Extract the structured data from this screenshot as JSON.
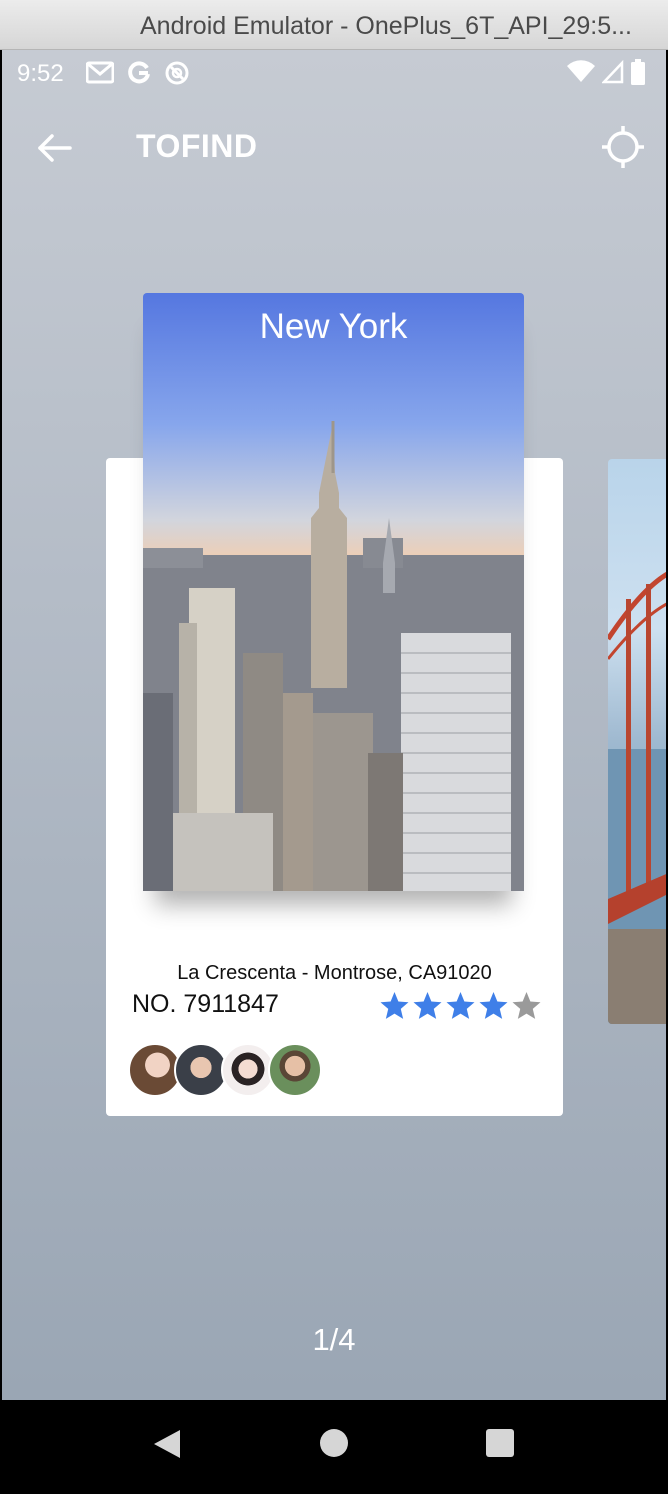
{
  "window": {
    "title": "Android Emulator - OnePlus_6T_API_29:5..."
  },
  "status_bar": {
    "time": "9:52",
    "left_icons": [
      "gmail-icon",
      "google-icon",
      "data-saver-icon"
    ],
    "right_icons": [
      "wifi-icon",
      "cell-signal-icon",
      "battery-icon"
    ]
  },
  "app_bar": {
    "back_icon": "arrow-back-icon",
    "title": "TOFIND",
    "action_icon": "my-location-icon"
  },
  "card": {
    "city": "New York",
    "location": "La Crescenta - Montrose, CA91020",
    "number": "NO. 7911847",
    "rating": {
      "value": 4,
      "max": 5
    },
    "avatars": [
      "avatar-1",
      "avatar-2",
      "avatar-3",
      "avatar-4"
    ]
  },
  "pager": {
    "indicator": "1/4"
  },
  "colors": {
    "star_active": "#3f7fe8",
    "star_inactive": "#9a9a9a",
    "card_bg": "#ffffff",
    "text_dark": "#111111"
  },
  "nav_bar": [
    "back-triangle-icon",
    "home-circle-icon",
    "recents-square-icon"
  ]
}
